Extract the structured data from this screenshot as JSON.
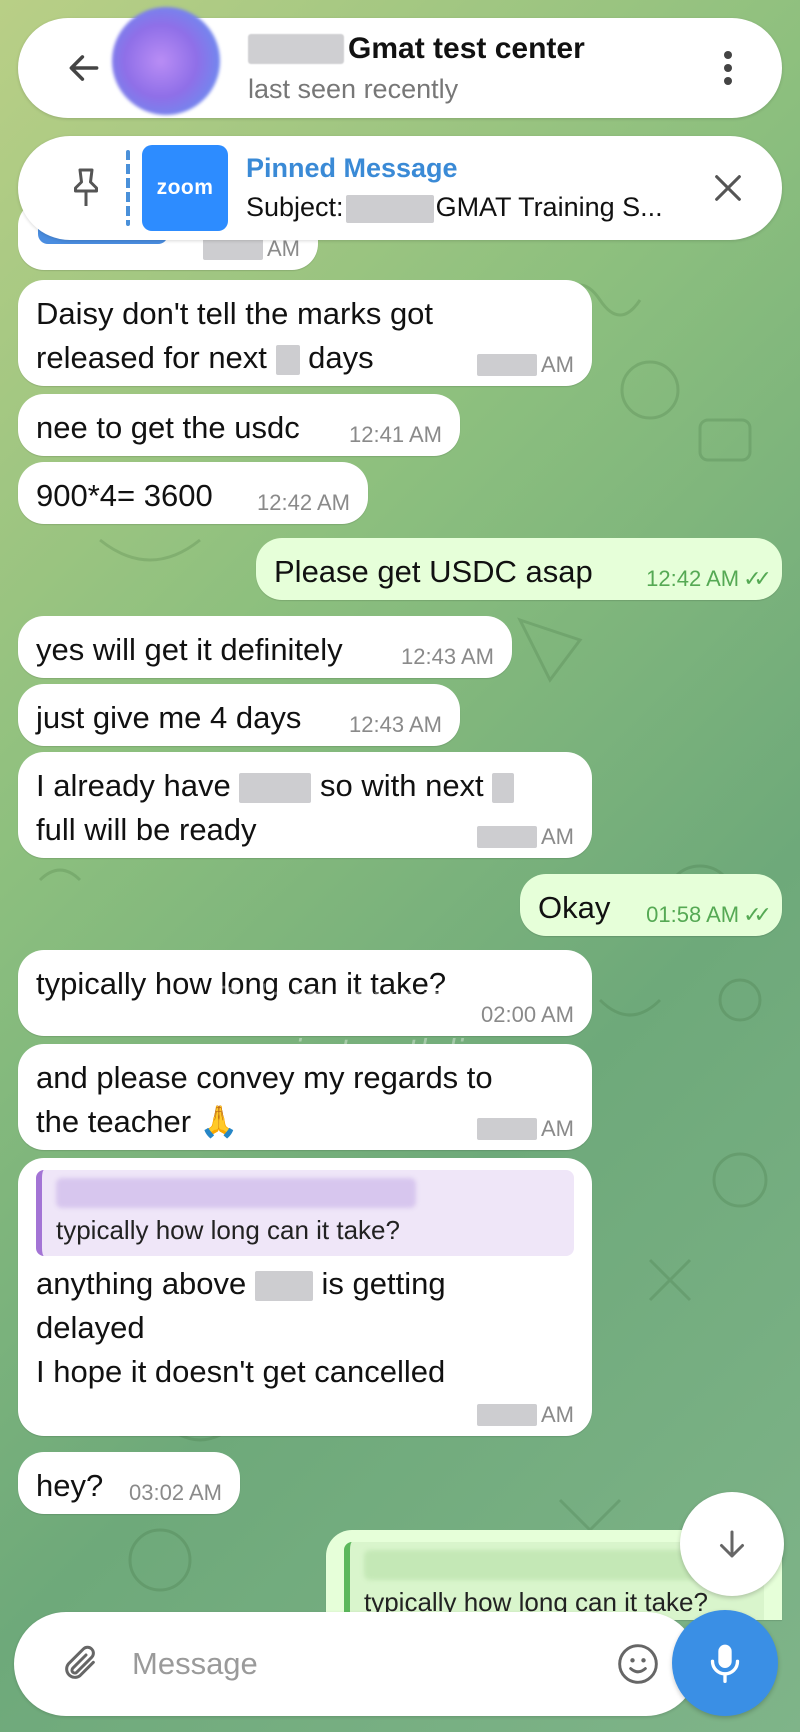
{
  "header": {
    "title": "Gmat test center",
    "status": "last seen recently"
  },
  "pinned": {
    "label": "Pinned Message",
    "subject_prefix": "Subject:",
    "subject_text": "GMAT Training S...",
    "logo_text": "zoom"
  },
  "messages": [
    {
      "text_1": "Daisy don't tell the marks got",
      "text_2a": "released for next",
      "text_2b": "days",
      "time": "AM"
    },
    {
      "text": "nee to get the usdc",
      "time": "12:41 AM"
    },
    {
      "text": "900*4= 3600",
      "time": "12:42 AM"
    },
    {
      "text": "Please get USDC asap",
      "time": "12:42 AM"
    },
    {
      "text": "yes will get it definitely",
      "time": "12:43 AM"
    },
    {
      "text": "just give me 4 days",
      "time": "12:43 AM"
    },
    {
      "text_1a": "I already have",
      "text_1b": "so with next",
      "text_2": "full will be ready",
      "time": "AM"
    },
    {
      "text": "Okay",
      "time": "01:58 AM"
    },
    {
      "text": "typically how long can it take?",
      "time": "02:00 AM"
    },
    {
      "text_1": "and please convey my regards to",
      "text_2": "the teacher 🙏",
      "time": "AM"
    },
    {
      "quote": "typically how long can it take?",
      "text_1a": "anything above",
      "text_1b": "is getting",
      "text_2": "delayed",
      "text_3": "I hope it doesn't get cancelled",
      "time": "AM"
    },
    {
      "text": "hey?",
      "time": "03:02 AM"
    },
    {
      "quote": "typically how long can it take?"
    }
  ],
  "top_time": "AM",
  "input": {
    "placeholder": "Message"
  },
  "watermark": {
    "handle": "@daisyexams",
    "site": "examinator.eth.limo"
  },
  "colors": {
    "outgoing": "#e6ffd9",
    "incoming": "#ffffff",
    "accent": "#3a8fe5"
  }
}
